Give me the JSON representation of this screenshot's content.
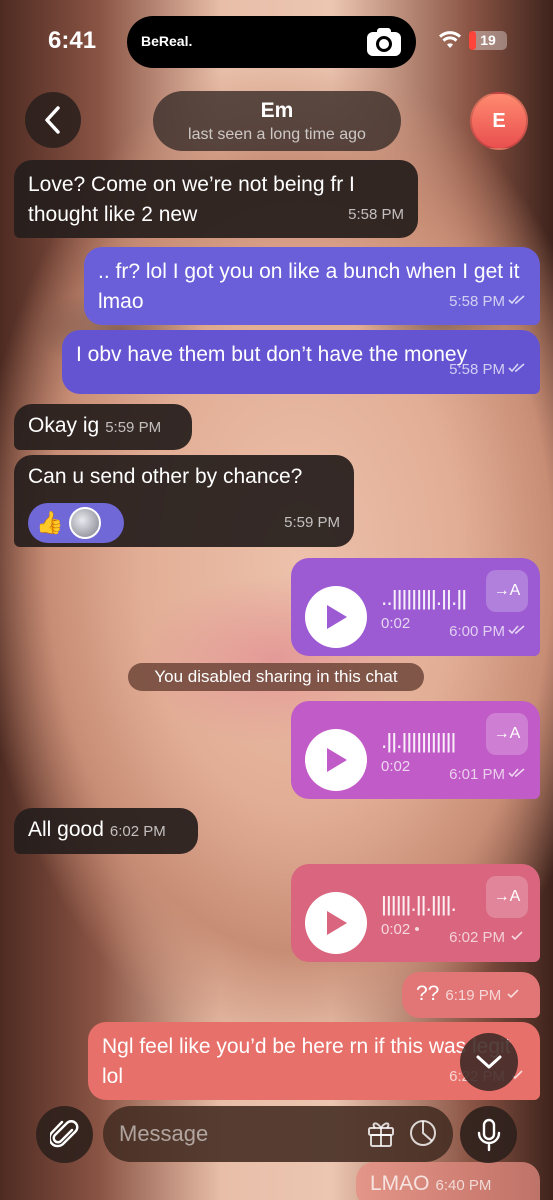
{
  "status_bar": {
    "time": "6:41",
    "island_app": "BeReal.",
    "battery": "19",
    "battery_level": 0.19
  },
  "header": {
    "contact_name": "Em",
    "contact_status": "last seen a long time ago",
    "avatar_initial": "E"
  },
  "messages": [
    {
      "text": "Love? Come on we’re not being fr I thought like 2 new",
      "time": "5:58 PM"
    },
    {
      "text": ".. fr? lol I got you on like a bunch when I get it lmao",
      "time": "5:58 PM"
    },
    {
      "text": "I obv have them but don’t have the money",
      "time": "5:58 PM"
    },
    {
      "text": "Okay ig",
      "time": "5:59 PM"
    },
    {
      "text": "Can u send other by chance?",
      "time": "5:59 PM",
      "reaction": "👍"
    },
    {
      "duration": "0:02",
      "time": "6:00 PM",
      "transcribe": "→A"
    },
    {
      "duration": "0:02",
      "time": "6:01 PM",
      "transcribe": "→A"
    },
    {
      "text": "All good",
      "time": "6:02 PM"
    },
    {
      "duration": "0:02",
      "time": "6:02 PM",
      "transcribe": "→A",
      "unplayed_dot": "•"
    },
    {
      "text": "??",
      "time": "6:19 PM"
    },
    {
      "text": "Ngl feel like you’d be here rn if this was legit lol",
      "time": "6:22 PM"
    },
    {
      "text": "LMAO",
      "time": "6:40 PM"
    }
  ],
  "system_notice": "You disabled sharing in this chat",
  "composer": {
    "placeholder": "Message"
  },
  "colors": {
    "incoming": "#261e1c",
    "outgoing_blue": "#6a5fd8",
    "outgoing_purple": "#9c5bd2",
    "outgoing_pink": "#d9657e",
    "outgoing_coral": "#e7706a"
  },
  "icons": [
    "back-icon",
    "camera-icon",
    "wifi-icon",
    "play-icon",
    "chevron-down-icon",
    "paperclip-icon",
    "gift-icon",
    "sticker-icon",
    "microphone-icon",
    "double-check-icon"
  ]
}
